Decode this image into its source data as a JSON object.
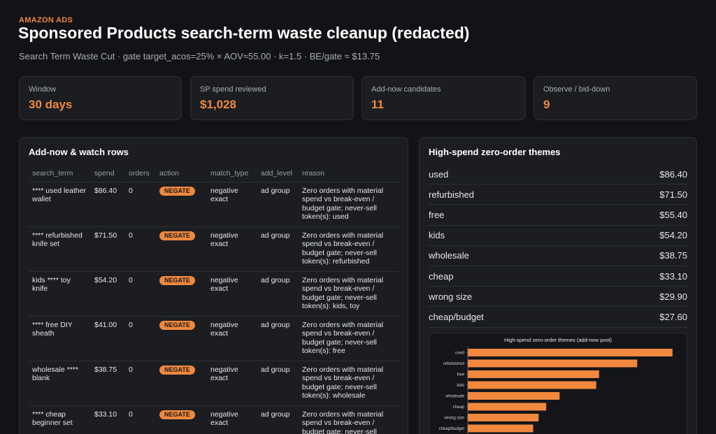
{
  "header": {
    "eyebrow": "AMAZON ADS",
    "title": "Sponsored Products search-term waste cleanup (redacted)",
    "subtitle": "Search Term Waste Cut · gate target_acos=25% × AOV≈55.00 · k=1.5 · BE/gate ≈ $13.75"
  },
  "kpis": [
    {
      "label": "Window",
      "value": "30 days"
    },
    {
      "label": "SP spend reviewed",
      "value": "$1,028"
    },
    {
      "label": "Add-now candidates",
      "value": "11"
    },
    {
      "label": "Observe / bid-down",
      "value": "9"
    }
  ],
  "rows_panel": {
    "title": "Add-now & watch rows",
    "columns": [
      "search_term",
      "spend",
      "orders",
      "action",
      "match_type",
      "add_level",
      "reason"
    ],
    "rows": [
      {
        "search_term": "**** used leather wallet",
        "spend": "$86.40",
        "orders": "0",
        "action": "NEGATE",
        "match_type": "negative exact",
        "add_level": "ad group",
        "reason": "Zero orders with material spend vs break-even / budget gate; never-sell token(s): used"
      },
      {
        "search_term": "**** refurbished knife set",
        "spend": "$71.50",
        "orders": "0",
        "action": "NEGATE",
        "match_type": "negative exact",
        "add_level": "ad group",
        "reason": "Zero orders with material spend vs break-even / budget gate; never-sell token(s): refurbished"
      },
      {
        "search_term": "kids **** toy knife",
        "spend": "$54.20",
        "orders": "0",
        "action": "NEGATE",
        "match_type": "negative exact",
        "add_level": "ad group",
        "reason": "Zero orders with material spend vs break-even / budget gate; never-sell token(s): kids, toy"
      },
      {
        "search_term": "**** free DIY sheath",
        "spend": "$41.00",
        "orders": "0",
        "action": "NEGATE",
        "match_type": "negative exact",
        "add_level": "ad group",
        "reason": "Zero orders with material spend vs break-even / budget gate; never-sell token(s): free"
      },
      {
        "search_term": "wholesale **** blank",
        "spend": "$38.75",
        "orders": "0",
        "action": "NEGATE",
        "match_type": "negative exact",
        "add_level": "ad group",
        "reason": "Zero orders with material spend vs break-even / budget gate; never-sell token(s): wholesale"
      },
      {
        "search_term": "**** cheap beginner set",
        "spend": "$33.10",
        "orders": "0",
        "action": "NEGATE",
        "match_type": "negative exact",
        "add_level": "ad group",
        "reason": "Zero orders with material spend vs break-even / budget gate; never-sell token(s): cheap"
      }
    ]
  },
  "themes_panel": {
    "title": "High-spend zero-order themes",
    "items": [
      {
        "name": "used",
        "value": "$86.40"
      },
      {
        "name": "refurbished",
        "value": "$71.50"
      },
      {
        "name": "free",
        "value": "$55.40"
      },
      {
        "name": "kids",
        "value": "$54.20"
      },
      {
        "name": "wholesale",
        "value": "$38.75"
      },
      {
        "name": "cheap",
        "value": "$33.10"
      },
      {
        "name": "wrong size",
        "value": "$29.90"
      },
      {
        "name": "cheap/budget",
        "value": "$27.60"
      }
    ]
  },
  "colors": {
    "accent": "#f0883e",
    "panel": "#1b1d21",
    "background": "#121316"
  },
  "chart_data": {
    "type": "bar",
    "orientation": "horizontal",
    "title": "High-spend zero-order themes (add-now pool)",
    "categories": [
      "used",
      "refurbished",
      "free",
      "kids",
      "wholesale",
      "cheap",
      "wrong size",
      "cheap/budget"
    ],
    "values": [
      86.4,
      71.5,
      55.4,
      54.2,
      38.75,
      33.1,
      29.9,
      27.6
    ],
    "xlim": [
      0,
      90
    ],
    "grid": false
  }
}
